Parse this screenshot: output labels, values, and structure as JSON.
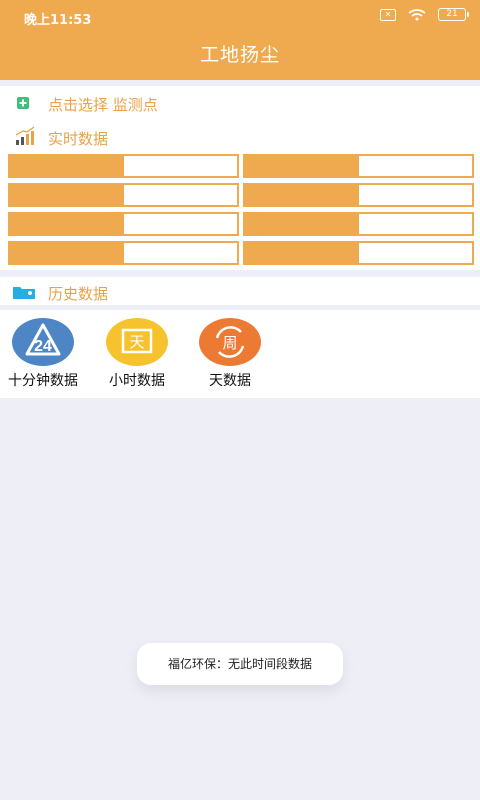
{
  "status_bar": {
    "time": "晚上11:53",
    "battery": "21"
  },
  "header": {
    "title": "工地扬尘"
  },
  "monitor_select": {
    "label": "点击选择 监测点"
  },
  "realtime": {
    "label": "实时数据",
    "cells": [
      {
        "key": "",
        "value": ""
      },
      {
        "key": "",
        "value": ""
      },
      {
        "key": "",
        "value": ""
      },
      {
        "key": "",
        "value": ""
      },
      {
        "key": "",
        "value": ""
      },
      {
        "key": "",
        "value": ""
      },
      {
        "key": "",
        "value": ""
      },
      {
        "key": "",
        "value": ""
      }
    ]
  },
  "history": {
    "label": "历史数据",
    "buttons": [
      {
        "label": "十分钟数据",
        "icon": "recycle-24-icon",
        "icon_text": "24",
        "color": "#4e86c5"
      },
      {
        "label": "小时数据",
        "icon": "hour-box-icon",
        "icon_text": "天",
        "color": "#f6c22d"
      },
      {
        "label": "天数据",
        "icon": "week-cycle-icon",
        "icon_text": "周",
        "color": "#ec7a33"
      }
    ]
  },
  "toast": {
    "text": "福亿环保：无此时间段数据"
  },
  "colors": {
    "accent": "#efaa4f",
    "accent_text": "#e8a24a",
    "page_bg": "#eeeff6"
  }
}
